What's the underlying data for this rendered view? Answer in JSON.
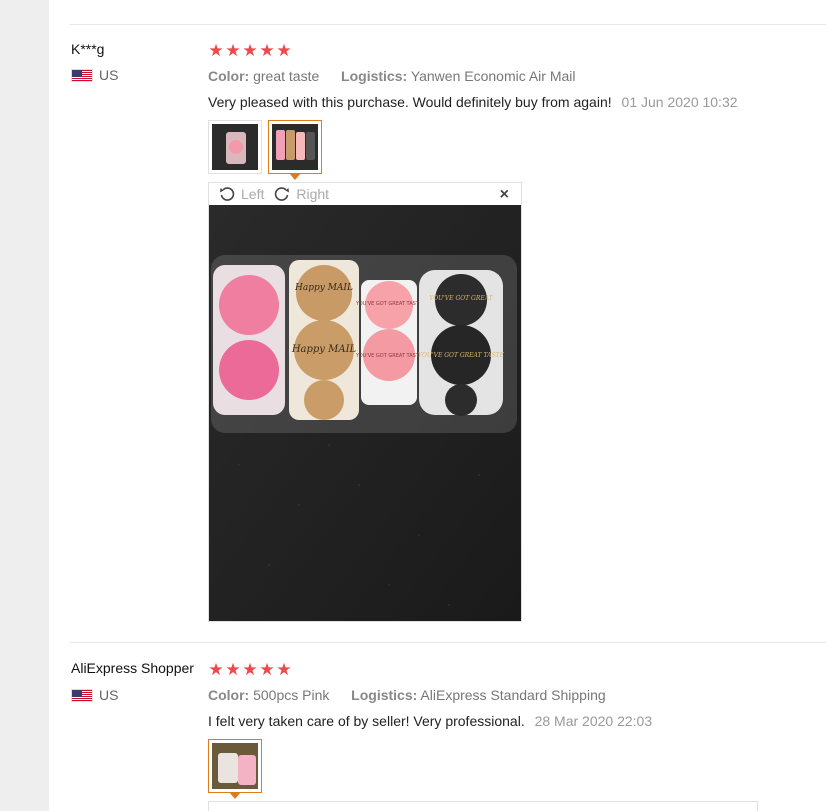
{
  "reviews": [
    {
      "user": "K***g",
      "country": "US",
      "stars": 5,
      "color_label": "Color:",
      "color_value": "great taste",
      "logistics_label": "Logistics:",
      "logistics_value": "Yanwen Economic Air Mail",
      "text": "Very pleased with this purchase. Would definitely buy from again!",
      "date": "01 Jun 2020 10:32",
      "viewer": {
        "left_label": "Left",
        "right_label": "Right",
        "close_label": "×"
      },
      "photo_labels": {
        "roll2_top": "Happy MAIL",
        "roll2_mid": "Happy MAIL",
        "roll3_top": "YOU'VE GOT GREAT TASTE",
        "roll3_mid": "YOU'VE GOT GREAT TASTE",
        "roll4_top": "YOU'VE GOT GREAT",
        "roll4_mid": "YOU'VE GOT GREAT TASTE"
      }
    },
    {
      "user": "AliExpress Shopper",
      "country": "US",
      "stars": 5,
      "color_label": "Color:",
      "color_value": "500pcs Pink",
      "logistics_label": "Logistics:",
      "logistics_value": "AliExpress Standard Shipping",
      "text": "I felt very taken care of by seller! Very professional.",
      "date": "28 Mar 2020 22:03"
    }
  ],
  "colors": {
    "star": "#f0494d",
    "active_border": "#e07b1b"
  }
}
